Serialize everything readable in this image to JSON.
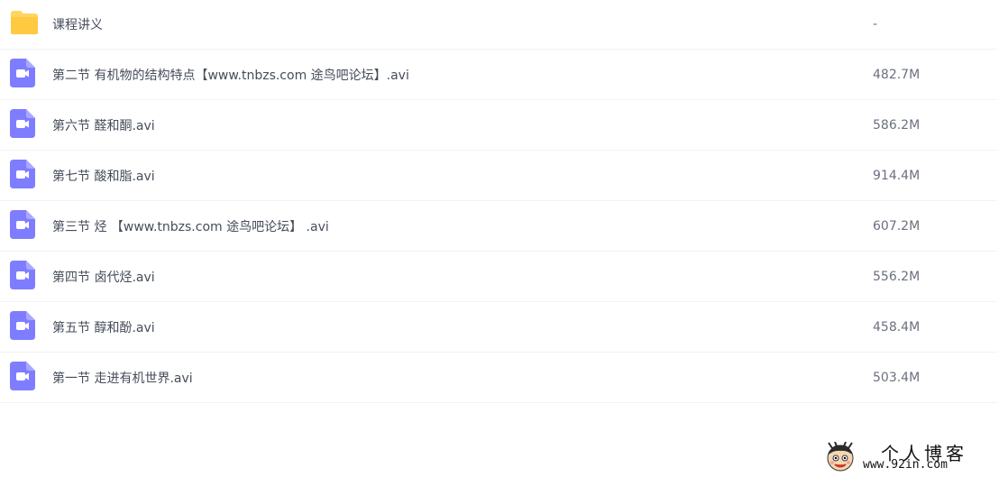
{
  "files": [
    {
      "name": "课程讲义",
      "size": "-",
      "icon": "folder-icon"
    },
    {
      "name": "第二节 有机物的结构特点【www.tnbzs.com 途鸟吧论坛】.avi",
      "size": "482.7M",
      "icon": "video-file-icon"
    },
    {
      "name": "第六节 醛和酮.avi",
      "size": "586.2M",
      "icon": "video-file-icon"
    },
    {
      "name": "第七节 酸和脂.avi",
      "size": "914.4M",
      "icon": "video-file-icon"
    },
    {
      "name": "第三节 烃 【www.tnbzs.com 途鸟吧论坛】 .avi",
      "size": "607.2M",
      "icon": "video-file-icon"
    },
    {
      "name": "第四节 卤代烃.avi",
      "size": "556.2M",
      "icon": "video-file-icon"
    },
    {
      "name": "第五节 醇和酚.avi",
      "size": "458.4M",
      "icon": "video-file-icon"
    },
    {
      "name": "第一节 走进有机世界.avi",
      "size": "503.4M",
      "icon": "video-file-icon"
    }
  ],
  "watermark": {
    "title": "个人博客",
    "url": "www.92in.com"
  },
  "colors": {
    "folder": "#ffd55e",
    "video": "#7f7dff",
    "divider": "#f1f2f4"
  }
}
